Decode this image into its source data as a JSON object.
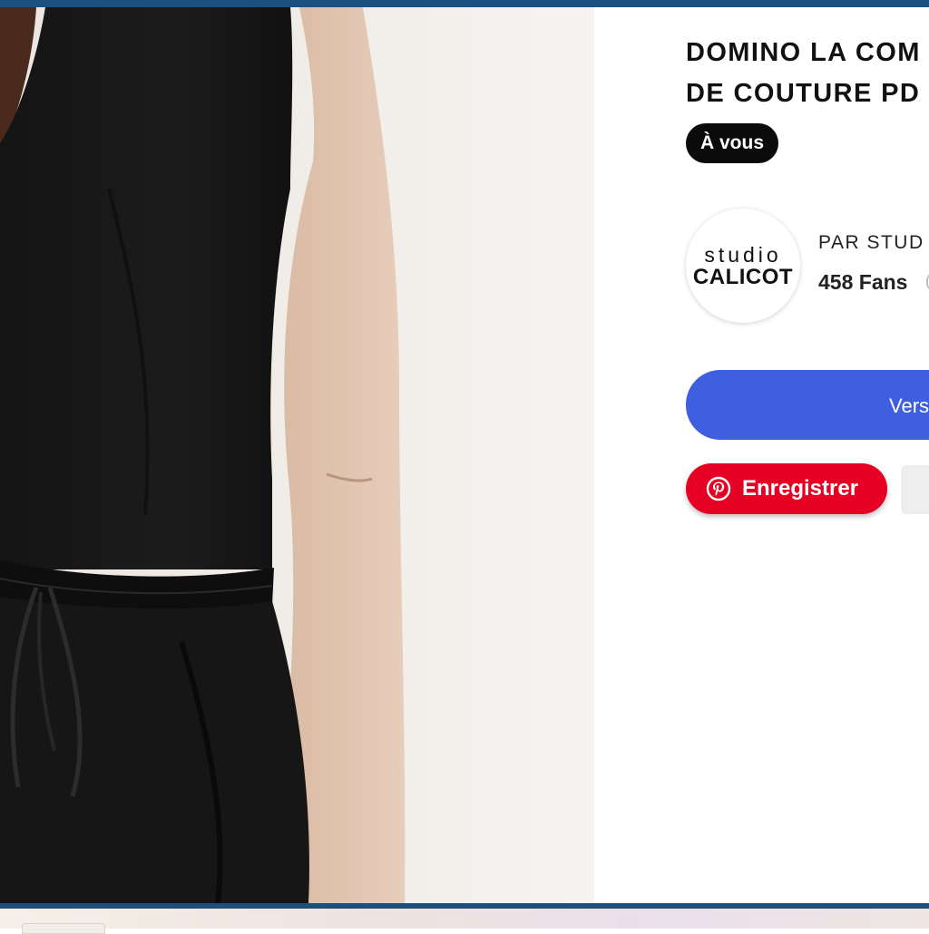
{
  "product": {
    "title_line1": "DOMINO LA COM",
    "title_line2": "DE COUTURE PD",
    "badge": "À vous",
    "image": "black-sleeveless-jumpsuit-photo"
  },
  "shop": {
    "logo_line1": "studio",
    "logo_line2": "CALICOT",
    "by_label": "PAR STUD",
    "fans_label": "458 Fans"
  },
  "actions": {
    "primary_label": "Vers",
    "pinterest_label": "Enregistrer",
    "pinterest_icon": "pinterest-icon"
  },
  "colors": {
    "primary": "#3d5fe0",
    "pinterest": "#e60023",
    "badge": "#0b0b0b",
    "frame": "#1d4f7c"
  }
}
